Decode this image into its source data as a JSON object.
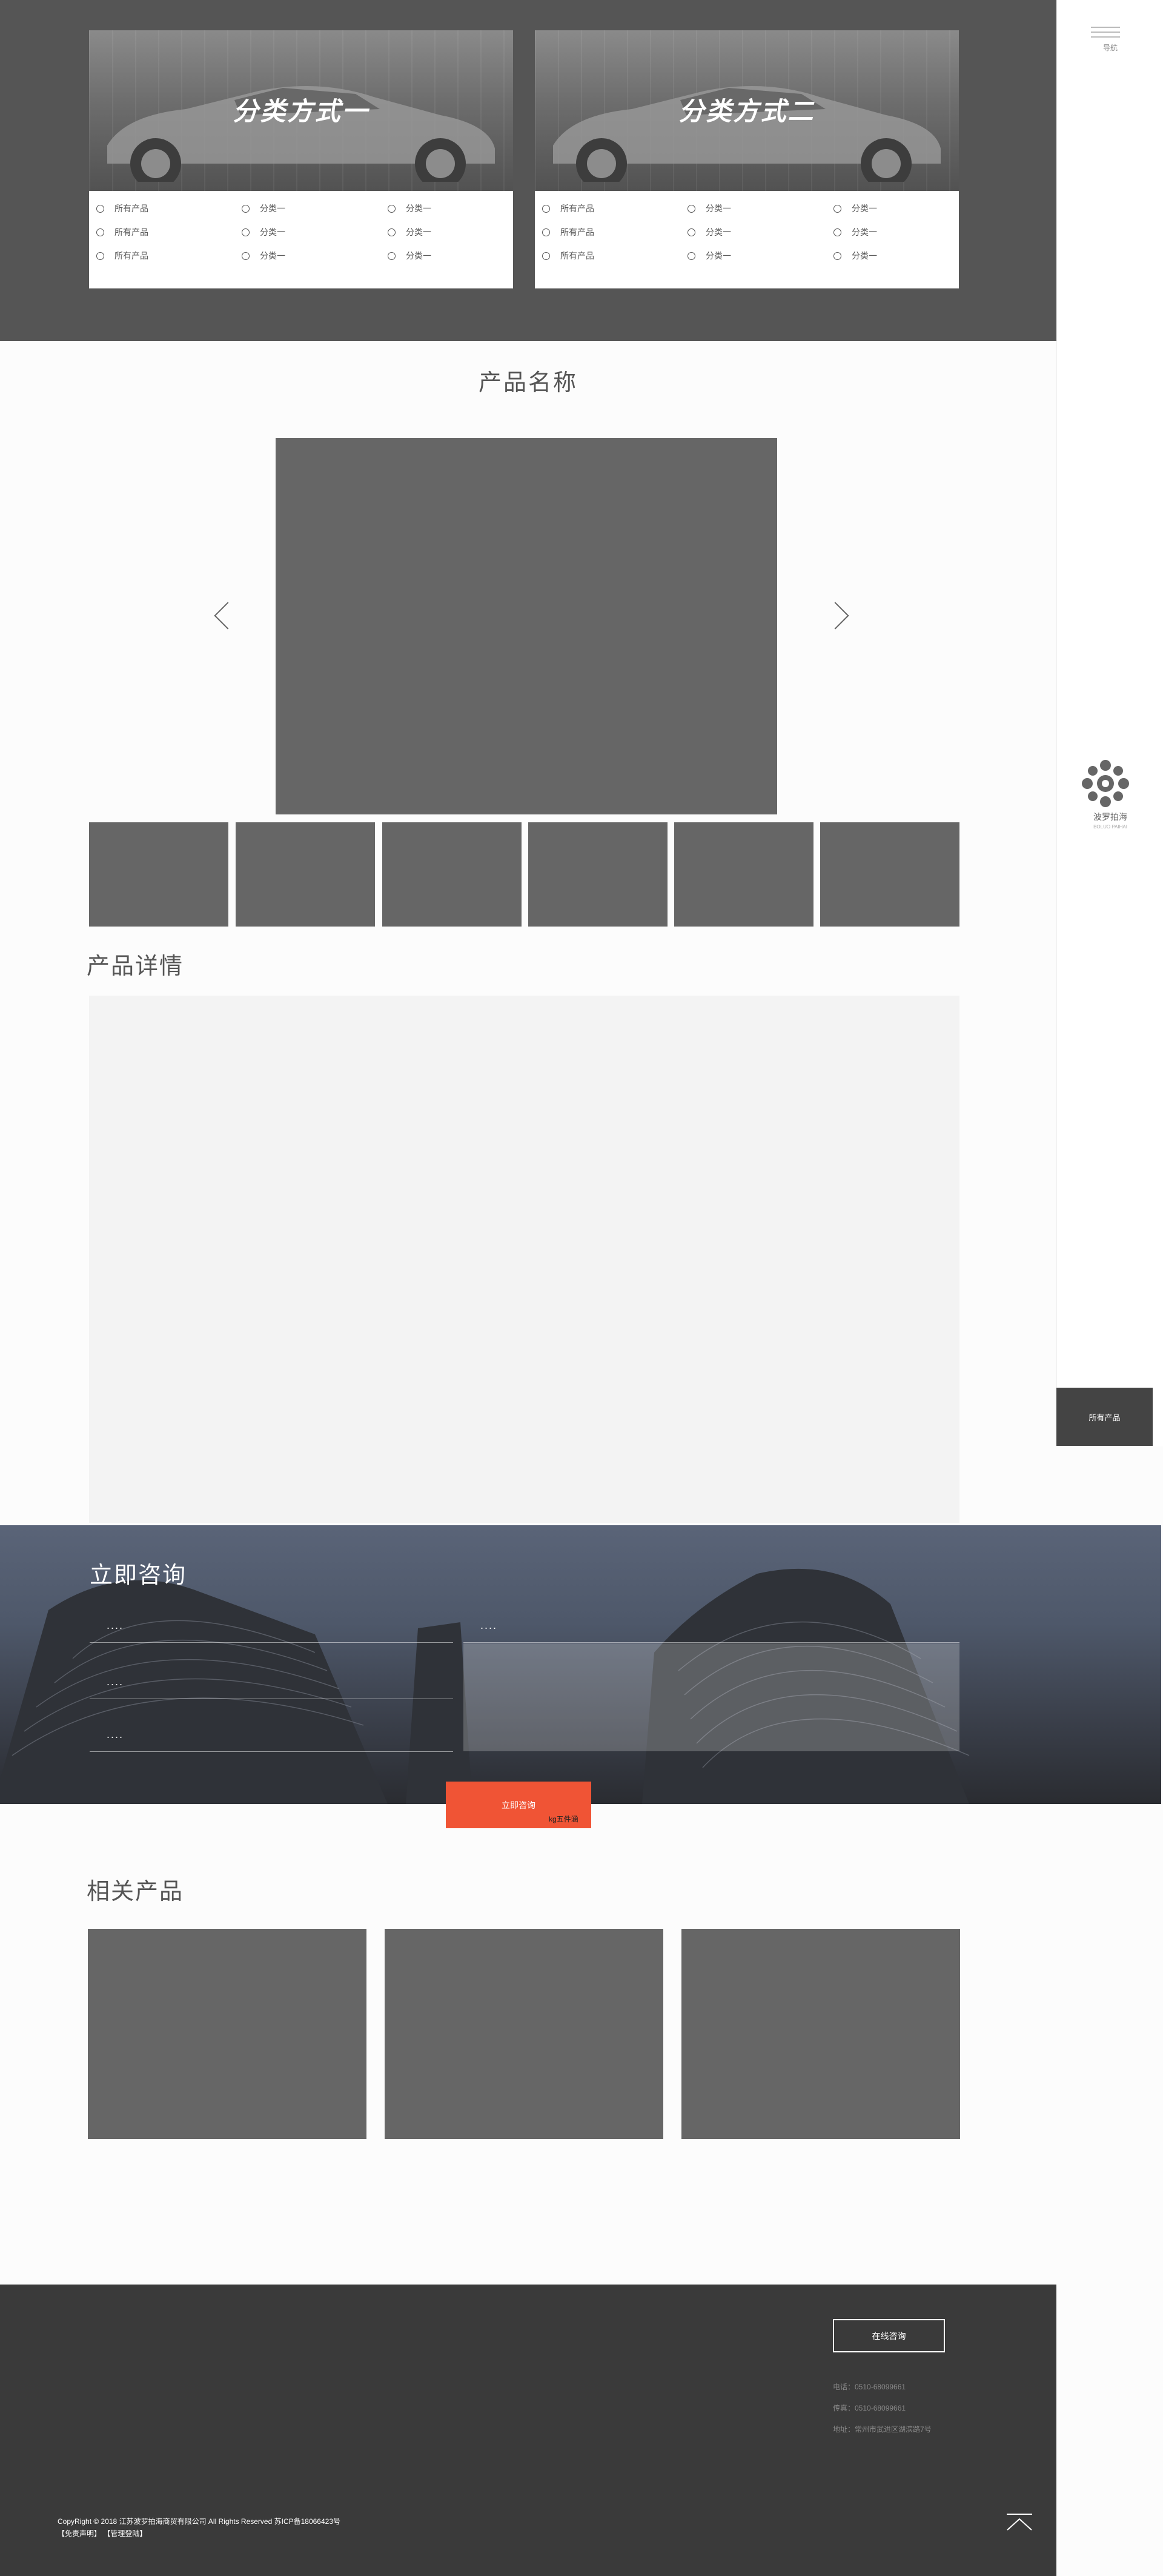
{
  "categories": [
    {
      "title": "分类方式一",
      "options": [
        "所有产品",
        "分类一",
        "分类一",
        "所有产品",
        "分类一",
        "分类一",
        "所有产品",
        "分类一",
        "分类一"
      ]
    },
    {
      "title": "分类方式二",
      "options": [
        "所有产品",
        "分类一",
        "分类一",
        "所有产品",
        "分类一",
        "分类一",
        "所有产品",
        "分类一",
        "分类一"
      ]
    }
  ],
  "sidebar": {
    "menu_label": "导航",
    "logo_text": "波罗拍海",
    "logo_sub": "BOLUO PAIHAI",
    "all_products": "所有产品"
  },
  "product": {
    "title": "产品名称",
    "details_title": "产品详情"
  },
  "consult": {
    "title": "立即咨询",
    "field_placeholders": [
      "....",
      "....",
      "....",
      "...."
    ],
    "submit": "立即咨询",
    "captcha": "kg五件涵"
  },
  "related": {
    "title": "相关产品"
  },
  "footer": {
    "online_button": "在线咨询",
    "phone": "电话：0510-68099661",
    "fax": "传真：0510-68099661",
    "address": "地址：常州市武进区湖滨路7号",
    "copyright": "CopyRight © 2018 江苏波罗拍海商贸有限公司 All Rights Reserved 苏ICP备18066423号",
    "links": "【免责声明】 【管理登陆】"
  },
  "colors": {
    "accent": "#f05435",
    "dark": "#3a3a3a",
    "placeholder_gray": "#666666"
  }
}
